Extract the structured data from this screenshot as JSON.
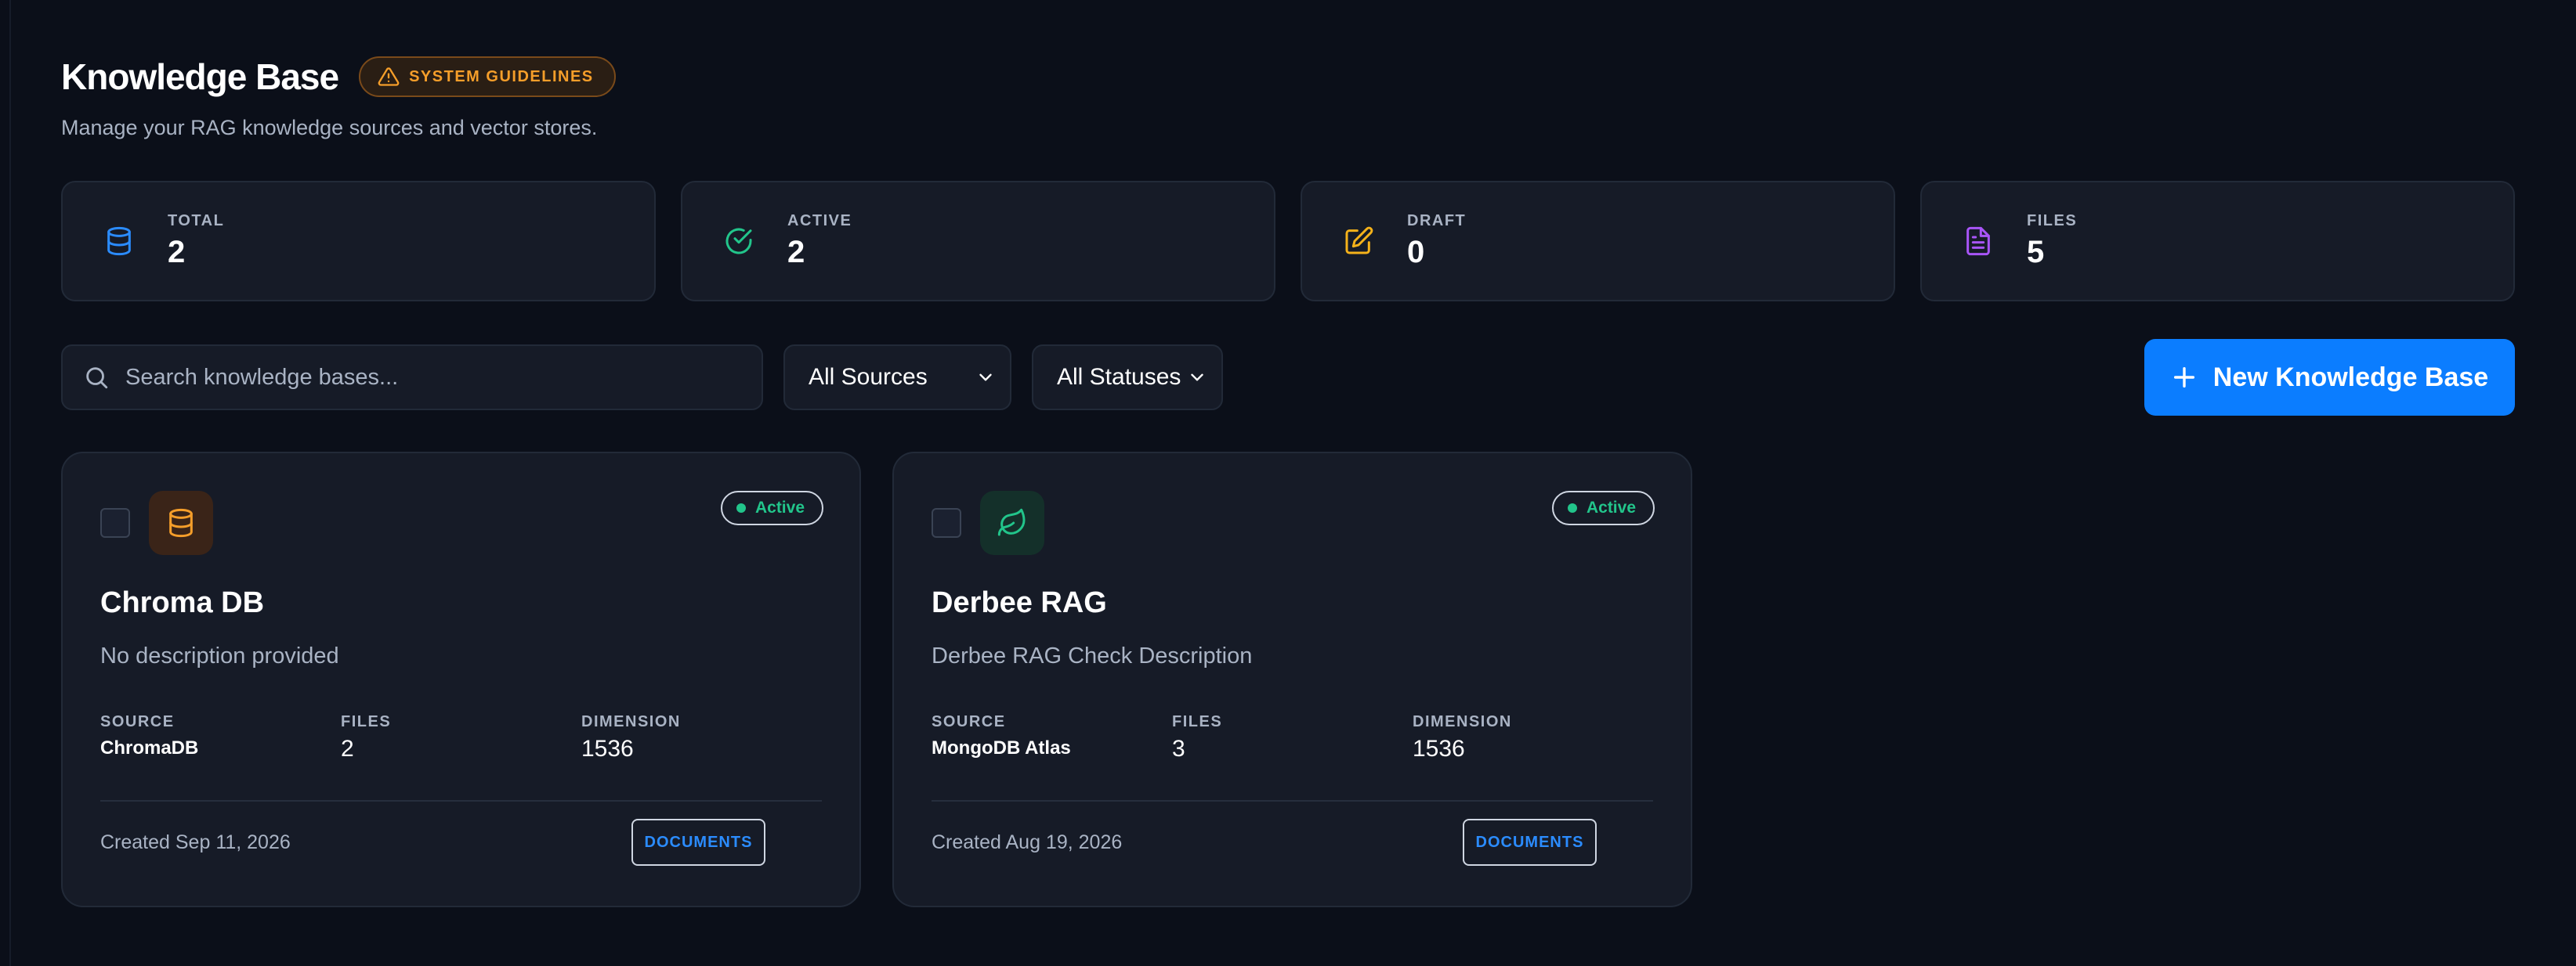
{
  "header": {
    "title": "Knowledge Base",
    "guidelines_badge": "SYSTEM GUIDELINES",
    "subtitle": "Manage your RAG knowledge sources and vector stores."
  },
  "stats": [
    {
      "label": "TOTAL",
      "value": "2",
      "icon": "database-icon",
      "color": "#2b8cff"
    },
    {
      "label": "ACTIVE",
      "value": "2",
      "icon": "check-circle-icon",
      "color": "#22c58b"
    },
    {
      "label": "DRAFT",
      "value": "0",
      "icon": "edit-icon",
      "color": "#f5b21a"
    },
    {
      "label": "FILES",
      "value": "5",
      "icon": "file-text-icon",
      "color": "#a855f7"
    }
  ],
  "toolbar": {
    "search_placeholder": "Search knowledge bases...",
    "sources_filter": "All Sources",
    "statuses_filter": "All Statuses",
    "new_button": "New Knowledge Base"
  },
  "cards": [
    {
      "name": "Chroma DB",
      "description": "No description provided",
      "status": "Active",
      "icon": "database-icon",
      "icon_color": "#f59e2a",
      "source_label": "SOURCE",
      "source": "ChromaDB",
      "files_label": "FILES",
      "files": "2",
      "dimension_label": "DIMENSION",
      "dimension": "1536",
      "created": "Created Sep 11, 2026",
      "documents_button": "DOCUMENTS"
    },
    {
      "name": "Derbee RAG",
      "description": "Derbee RAG Check Description",
      "status": "Active",
      "icon": "leaf-icon",
      "icon_color": "#22c58b",
      "source_label": "SOURCE",
      "source": "MongoDB Atlas",
      "files_label": "FILES",
      "files": "3",
      "dimension_label": "DIMENSION",
      "dimension": "1536",
      "created": "Created Aug 19, 2026",
      "documents_button": "DOCUMENTS"
    }
  ],
  "colors": {
    "background": "#0b0f19",
    "panel": "#161b27",
    "accent": "#0b7dff",
    "warning": "#f59e2a",
    "success": "#22c58b"
  }
}
